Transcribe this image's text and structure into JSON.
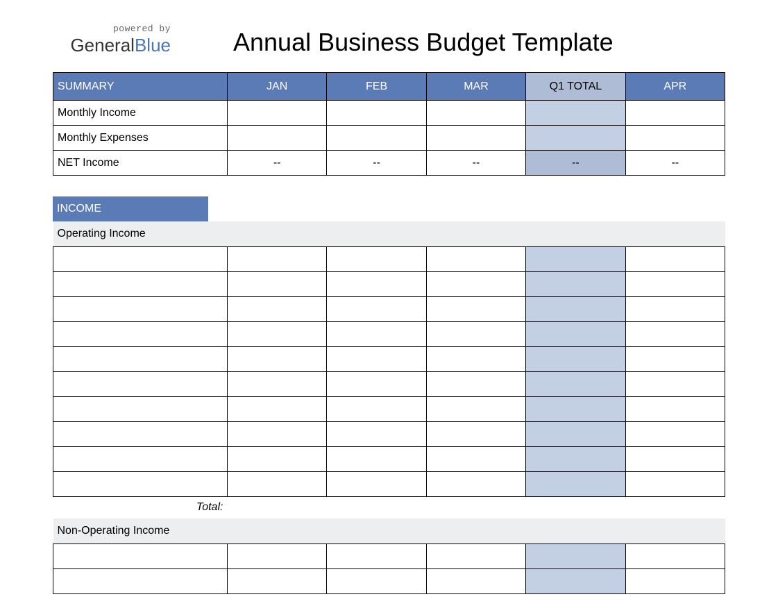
{
  "logo": {
    "powered": "powered by",
    "brand_a": "General",
    "brand_b": "Blue"
  },
  "title": "Annual Business Budget Template",
  "columns": {
    "summary": "SUMMARY",
    "c1": "JAN",
    "c2": "FEB",
    "c3": "MAR",
    "q": "Q1 TOTAL",
    "c4": "APR"
  },
  "summary_rows": {
    "r1": "Monthly Income",
    "r2": "Monthly Expenses",
    "r3": "NET Income",
    "dash": "--"
  },
  "income": {
    "section": "INCOME",
    "operating": "Operating Income",
    "total": "Total:",
    "non_operating": "Non-Operating Income"
  }
}
